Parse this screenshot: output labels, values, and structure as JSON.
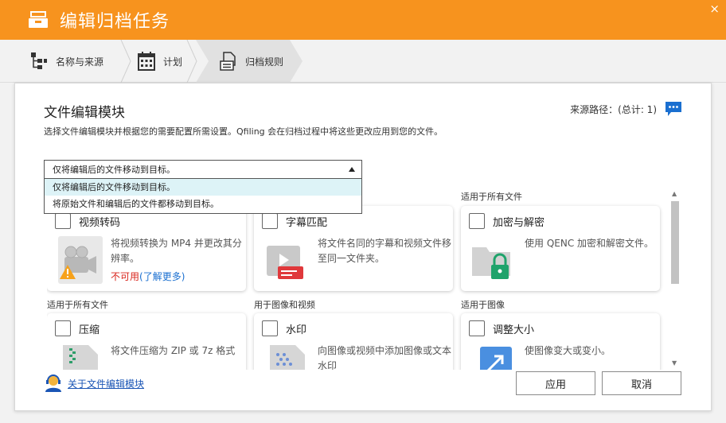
{
  "window": {
    "title": "编辑归档任务",
    "close_glyph": "×"
  },
  "steps": [
    {
      "label": "名称与来源",
      "icon": "tree-icon"
    },
    {
      "label": "计划",
      "icon": "calendar-icon"
    },
    {
      "label": "归档规则",
      "icon": "document-icon",
      "active": true
    }
  ],
  "header": {
    "title": "文件编辑模块",
    "description": "选择文件编辑模块并根据您的需要配置所需设置。Qfiling 会在归档过程中将这些更改应用到您的文件。",
    "source_path": "来源路径：(总计: 1)"
  },
  "select": {
    "value": "仅将编辑后的文件移动到目标。",
    "options": [
      "仅将编辑后的文件移动到目标。",
      "将原始文件和编辑后的文件都移动到目标。"
    ]
  },
  "categories": {
    "row1_col3": "适用于所有文件",
    "row2_col1": "适用于所有文件",
    "row2_col2": "用于图像和视频",
    "row2_col3": "适用于图像"
  },
  "cards": {
    "video": {
      "name": "视频转码",
      "desc": "将视频转换为 MP4 并更改其分辨率。",
      "unavailable": "不可用",
      "learn_more": "(了解更多)"
    },
    "subtitle": {
      "name": "字幕匹配",
      "desc": "将文件名同的字幕和视频文件移至同一文件夹。"
    },
    "encrypt": {
      "name": "加密与解密",
      "desc": "使用 QENC 加密和解密文件。"
    },
    "compress": {
      "name": "压缩",
      "desc": "将文件压缩为 ZIP 或 7z 格式"
    },
    "watermark": {
      "name": "水印",
      "desc": "向图像或视频中添加图像或文本水印"
    },
    "resize": {
      "name": "调整大小",
      "desc": "使图像变大或变小。"
    }
  },
  "footer": {
    "about": "关于文件编辑模块",
    "apply": "应用",
    "cancel": "取消"
  },
  "colors": {
    "titlebar": "#f7931e",
    "link": "#1a6fd0",
    "error": "#d9251c",
    "selected_option": "#ddf3f7"
  }
}
